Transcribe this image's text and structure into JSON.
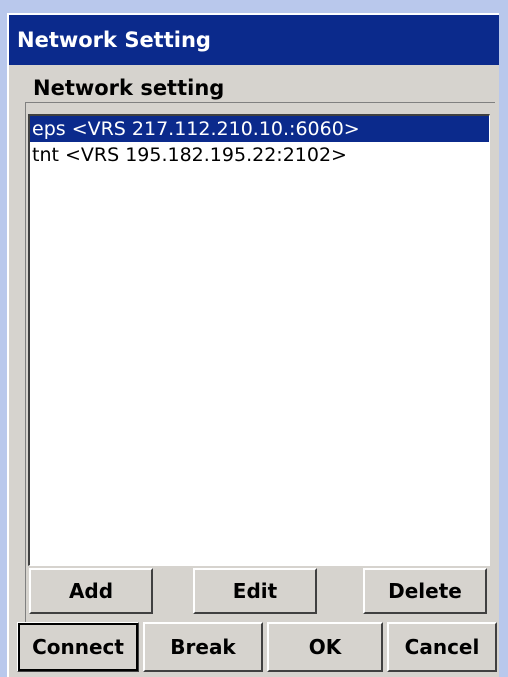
{
  "window": {
    "title": "Network Setting"
  },
  "group": {
    "label": "Network setting"
  },
  "list": {
    "items": [
      {
        "label": "eps <VRS  217.112.210.10.:6060>",
        "selected": true
      },
      {
        "label": "tnt <VRS  195.182.195.22:2102>",
        "selected": false
      }
    ]
  },
  "buttons": {
    "add": "Add",
    "edit": "Edit",
    "delete": "Delete",
    "connect": "Connect",
    "break": "Break",
    "ok": "OK",
    "cancel": "Cancel"
  },
  "colors": {
    "title_bar": "#0b2a8c",
    "selection": "#0b2a8c",
    "dialog_face": "#d6d3ce",
    "desktop": "#b9c8ec"
  }
}
